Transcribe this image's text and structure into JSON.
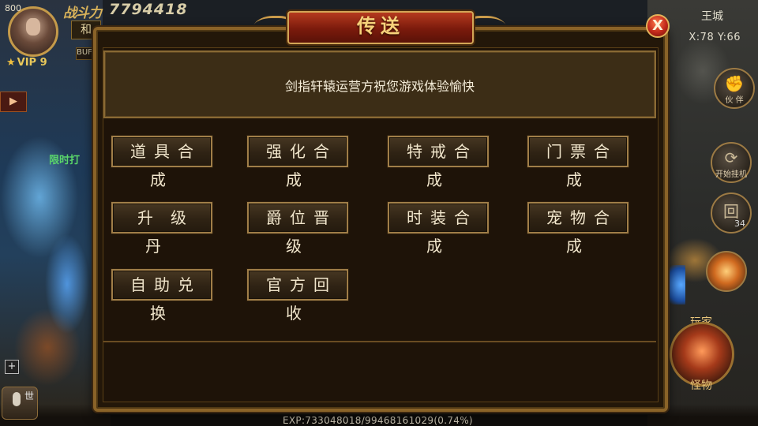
{
  "hud": {
    "level": "800",
    "combat_power_label": "战斗力",
    "combat_power_value": "7794418",
    "name_button": "和",
    "buff_label": "BUF",
    "vip": "VIP 9",
    "limited_label": "限时打",
    "city": "王城",
    "coords": "X:78 Y:66",
    "btn_partner": "伙 伴",
    "btn_auto": "开始挂机",
    "btn_return": "回",
    "btn_return_count": "34",
    "player_label": "玩家",
    "monster_label": "怪物",
    "world_label": "世",
    "exp_text": "EXP:733048018/99468161029(0.74%)"
  },
  "dialog": {
    "title": "传送",
    "close_label": "X",
    "notice": "剑指轩辕运营方祝您游戏体验愉快",
    "buttons": [
      "道具合成",
      "强化合成",
      "特戒合成",
      "门票合成",
      "升级丹",
      "爵位晋级",
      "时装合成",
      "宠物合成",
      "自助兑换",
      "官方回收"
    ]
  },
  "colors": {
    "panel_bg": "#231709",
    "panel_border": "#8a6328",
    "title_red": "#b53a1e",
    "title_gold": "#f6d27a",
    "button_text": "#f1e6cc"
  }
}
